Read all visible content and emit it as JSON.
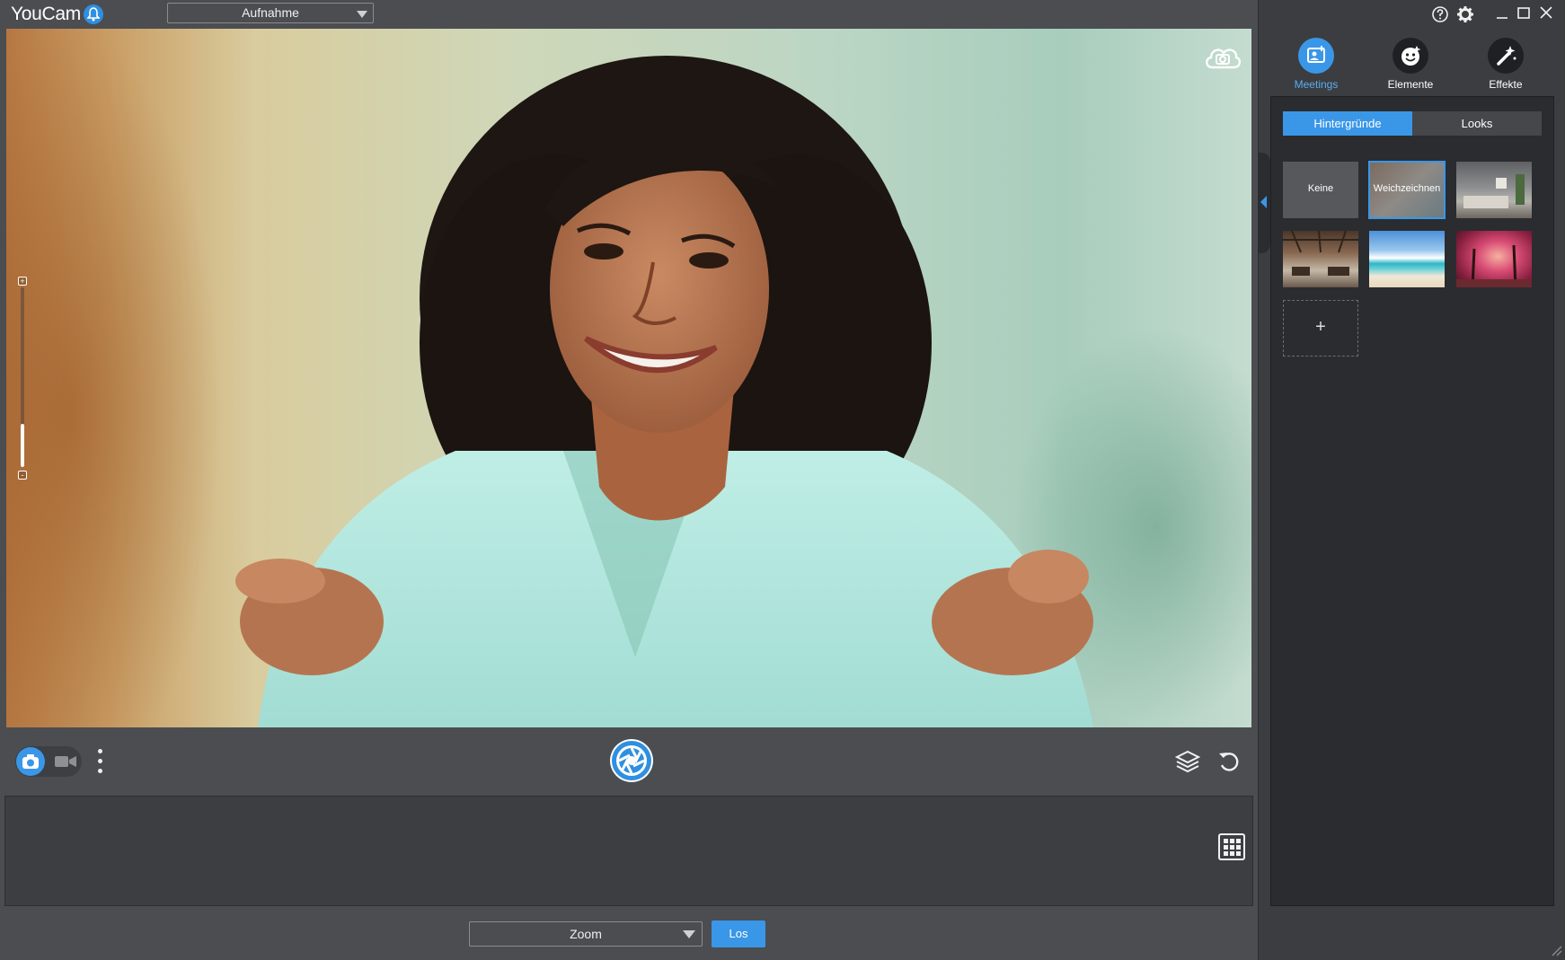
{
  "app": {
    "title": "YouCam",
    "mode_selected": "Aufnahme"
  },
  "colors": {
    "accent": "#3a97e8",
    "background": "#4b4d51",
    "panel": "#2a2c30"
  },
  "right_panel": {
    "tabs": [
      {
        "label": "Meetings",
        "icon": "meetings-icon",
        "active": true
      },
      {
        "label": "Elemente",
        "icon": "elements-face-icon",
        "active": false
      },
      {
        "label": "Effekte",
        "icon": "effects-wand-icon",
        "active": false
      }
    ],
    "subtabs": [
      {
        "label": "Hintergründe",
        "active": true
      },
      {
        "label": "Looks",
        "active": false
      }
    ],
    "backgrounds": [
      {
        "label": "Keine",
        "kind": "none"
      },
      {
        "label": "Weichzeichnen",
        "kind": "blur",
        "selected": true
      },
      {
        "label": "",
        "kind": "living-room"
      },
      {
        "label": "",
        "kind": "cafe"
      },
      {
        "label": "",
        "kind": "beach"
      },
      {
        "label": "",
        "kind": "pink-forest"
      }
    ],
    "add_label": "+"
  },
  "bottom": {
    "app_selected": "Zoom",
    "go_label": "Los"
  }
}
